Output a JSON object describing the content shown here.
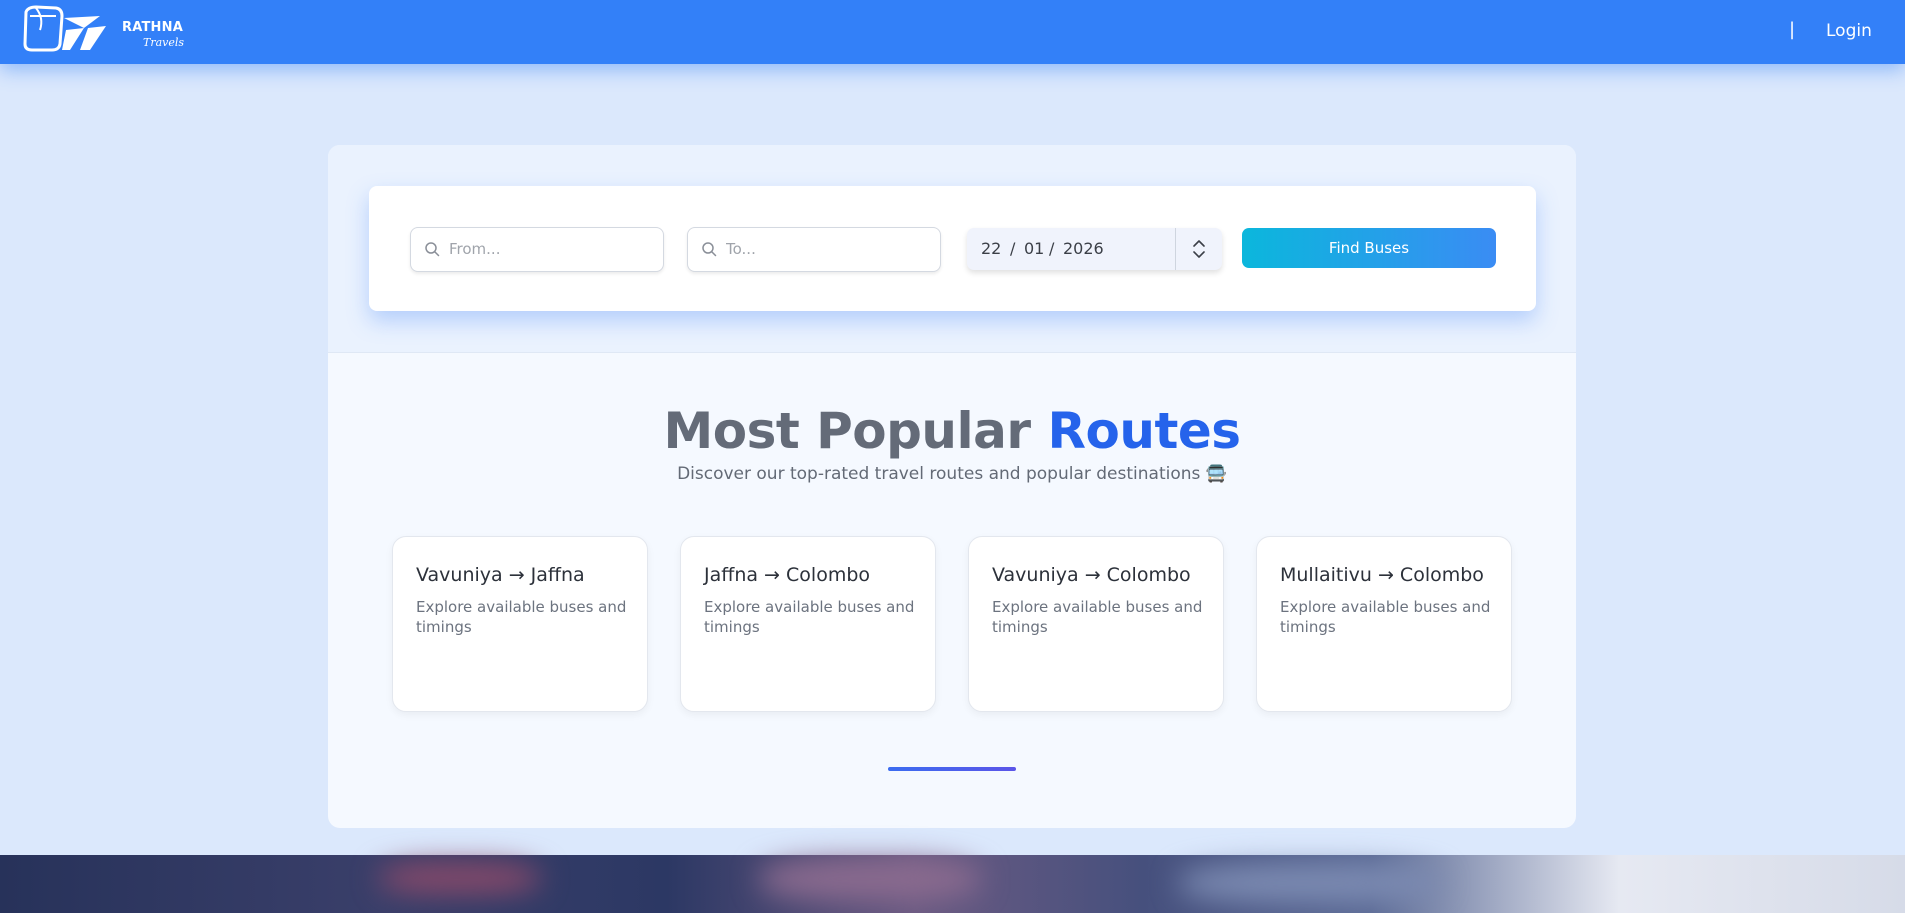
{
  "header": {
    "brand_name": "RATHNA",
    "brand_sub": "Travels",
    "separator": "|",
    "login_label": "Login"
  },
  "search": {
    "from_placeholder": "From...",
    "to_placeholder": "To...",
    "date": {
      "day": "22",
      "month": "01",
      "year": "2026"
    },
    "find_label": "Find Buses"
  },
  "popular": {
    "title_main": "Most Popular",
    "title_accent": "Routes",
    "subtitle": "Discover our top-rated travel routes and popular destinations 🚍",
    "routes": [
      {
        "name": "Vavuniya → Jaffna",
        "desc": "Explore available buses and timings"
      },
      {
        "name": "Jaffna → Colombo",
        "desc": "Explore available buses and timings"
      },
      {
        "name": "Vavuniya → Colombo",
        "desc": "Explore available buses and timings"
      },
      {
        "name": "Mullaitivu → Colombo",
        "desc": "Explore available buses and timings"
      }
    ]
  },
  "colors": {
    "header": "#3380f8",
    "accent": "#2563eb",
    "button_start": "#0bb7dc",
    "button_end": "#3a8cf4"
  }
}
